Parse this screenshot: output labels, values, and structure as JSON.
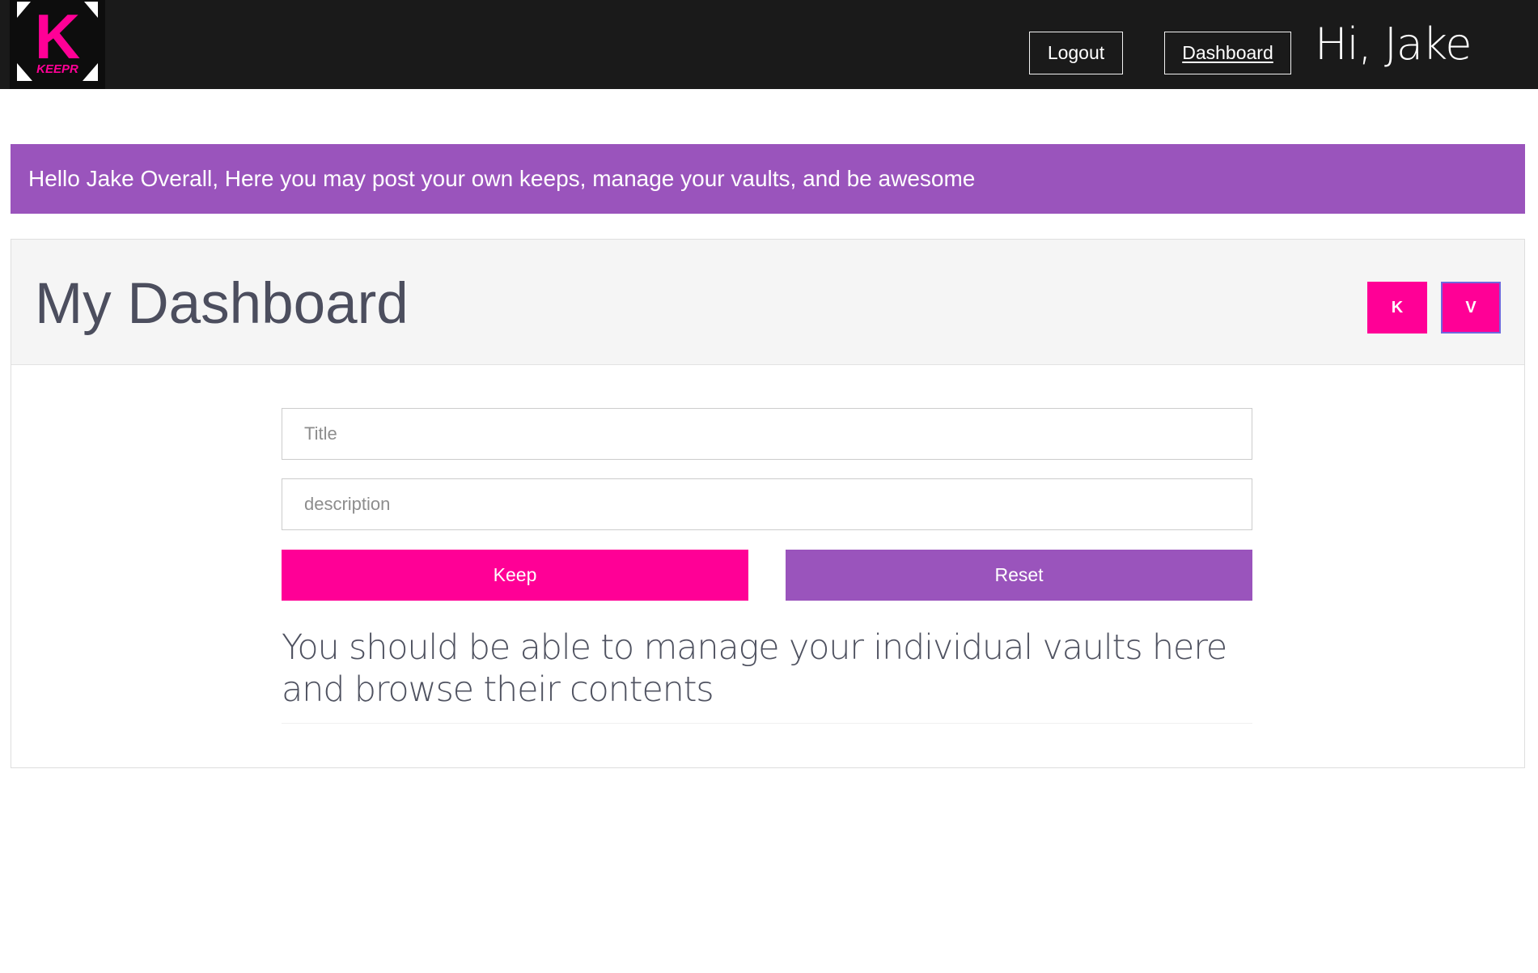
{
  "navbar": {
    "logo": {
      "letter": "K",
      "wordmark": "KEEPR",
      "accent": "#ff0096"
    },
    "logout_label": "Logout",
    "dashboard_label": "Dashboard",
    "greeting": "Hi, Jake"
  },
  "banner": {
    "text": "Hello Jake Overall, Here you may post your own keeps, manage your vaults, and be awesome",
    "color": "#9a54bc"
  },
  "dashboard": {
    "title": "My Dashboard",
    "tabs": [
      {
        "label": "K"
      },
      {
        "label": "V"
      }
    ],
    "form": {
      "title_placeholder": "Title",
      "description_placeholder": "description",
      "keep_label": "Keep",
      "reset_label": "Reset"
    },
    "vault_note": "You should be able to manage your individual vaults here and browse their contents"
  },
  "colors": {
    "navbar": "#1a1a1a",
    "primary": "#ff0096",
    "secondary": "#9a54bc",
    "heading": "#4c4e5e"
  }
}
